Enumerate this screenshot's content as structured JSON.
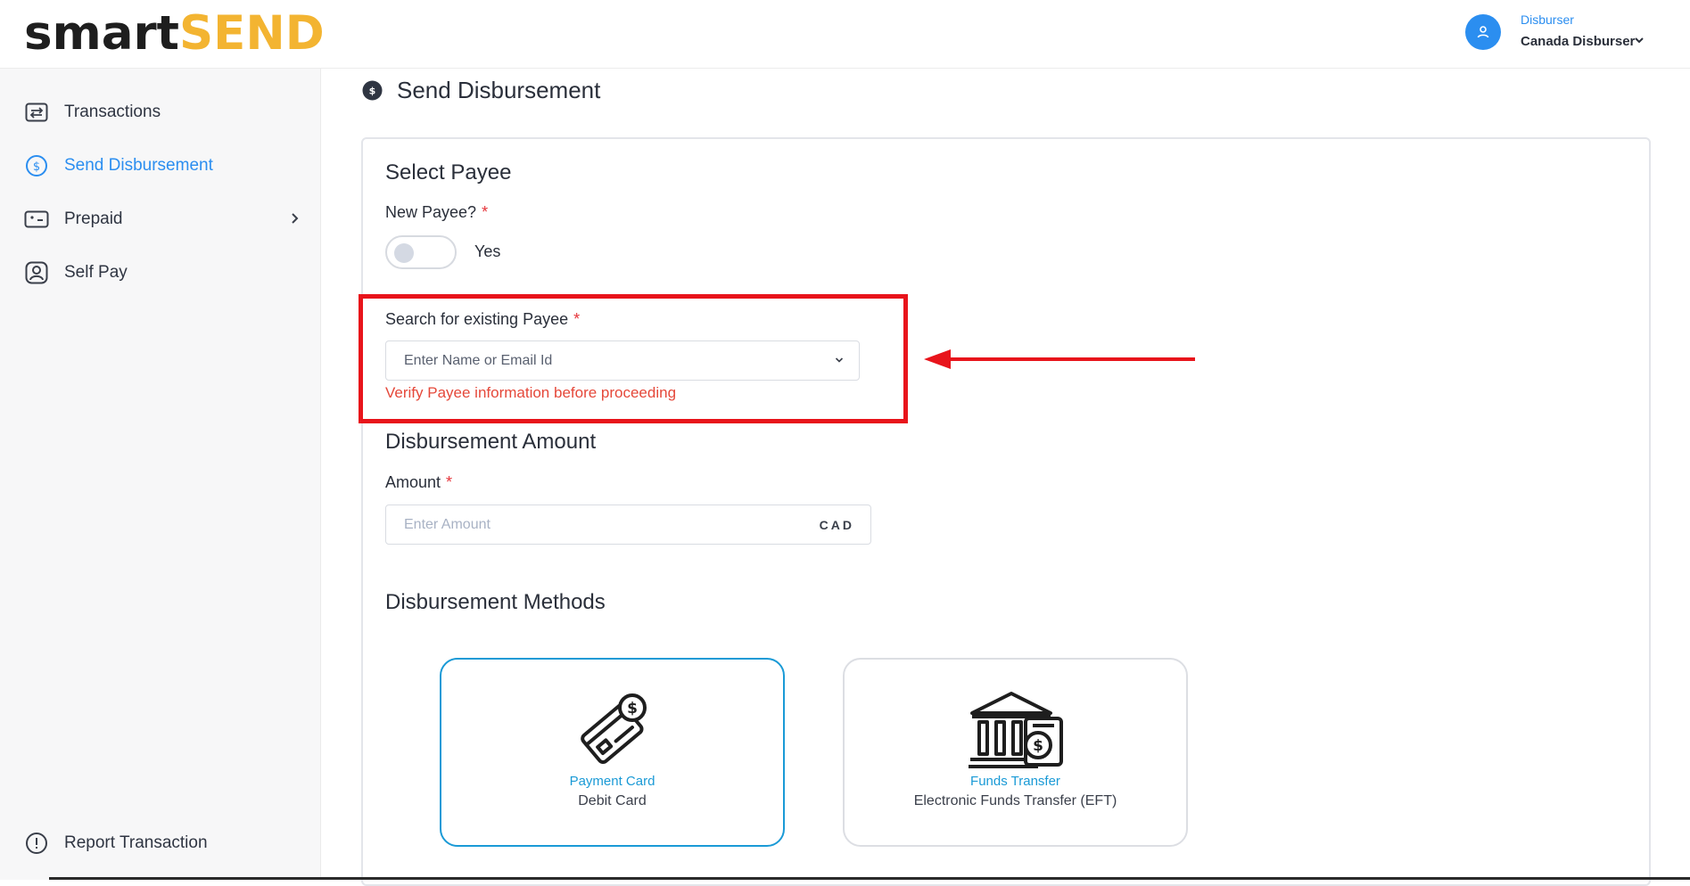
{
  "header": {
    "logo_part1": "smart",
    "logo_part2": "SEND",
    "user_role": "Disburser",
    "user_name": "Canada Disburser"
  },
  "sidebar": {
    "items": [
      {
        "label": "Transactions",
        "icon": "transactions-icon"
      },
      {
        "label": "Send Disbursement",
        "icon": "dollar-circle-icon",
        "active": true
      },
      {
        "label": "Prepaid",
        "icon": "cash-icon",
        "has_submenu": true
      },
      {
        "label": "Self Pay",
        "icon": "user-badge-icon"
      }
    ],
    "footer_item": {
      "label": "Report Transaction",
      "icon": "alert-circle-icon"
    }
  },
  "page": {
    "title": "Send Disbursement"
  },
  "form": {
    "select_payee": {
      "title": "Select Payee",
      "new_payee_label": "New Payee?",
      "new_payee_required": "*",
      "toggle_label": "Yes",
      "toggle_on": false,
      "search_label": "Search for existing Payee",
      "search_required": "*",
      "search_placeholder": "Enter Name or Email Id",
      "hint": "Verify Payee information before proceeding"
    },
    "amount": {
      "title": "Disbursement Amount",
      "label": "Amount",
      "required": "*",
      "placeholder": "Enter Amount",
      "currency": "CAD"
    },
    "methods": {
      "title": "Disbursement Methods",
      "items": [
        {
          "title": "Payment Card",
          "subtitle": "Debit Card",
          "icon": "payment-card-icon",
          "selected": true
        },
        {
          "title": "Funds Transfer",
          "subtitle": "Electronic Funds Transfer (EFT)",
          "icon": "bank-transfer-icon",
          "selected": false
        }
      ]
    }
  },
  "colors": {
    "accent": "#2b8ef0",
    "logo_accent": "#f3b431",
    "error": "#e5483a",
    "highlight": "#e8141b",
    "method_selected": "#1a9ad6"
  }
}
